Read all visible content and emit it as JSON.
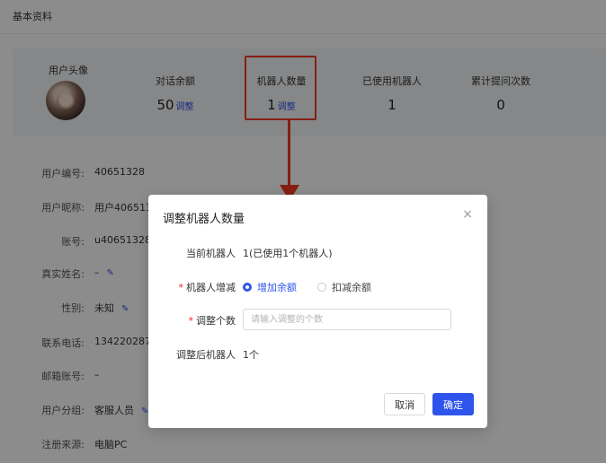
{
  "page": {
    "title": "基本资料"
  },
  "profile": {
    "avatar_label": "用户头像",
    "stats": [
      {
        "label": "对话余额",
        "value": "50",
        "adjust": "调整"
      },
      {
        "label": "机器人数量",
        "value": "1",
        "adjust": "调整"
      },
      {
        "label": "已使用机器人",
        "value": "1"
      },
      {
        "label": "累计提问次数",
        "value": "0"
      }
    ],
    "fields": [
      {
        "label": "用户编号:",
        "value": "40651328"
      },
      {
        "label": "用户昵称:",
        "value": "用户4065132"
      },
      {
        "label": "账号:",
        "value": "u40651328"
      },
      {
        "label": "真实姓名:",
        "value": "–"
      },
      {
        "label": "性别:",
        "value": "未知"
      },
      {
        "label": "联系电话:",
        "value": "1342202875"
      },
      {
        "label": "邮箱账号:",
        "value": "–"
      },
      {
        "label": "用户分组:",
        "value": "客服人员"
      },
      {
        "label": "注册来源:",
        "value": "电脑PC"
      }
    ]
  },
  "dialog": {
    "title": "调整机器人数量",
    "close_icon": "×",
    "current_label": "当前机器人",
    "current_value": "1(已使用1个机器人)",
    "change_label": "机器人增减",
    "options": [
      "增加余额",
      "扣减余额"
    ],
    "selected_option": "增加余额",
    "count_label": "调整个数",
    "count_placeholder": "请输入调整的个数",
    "after_label": "调整后机器人",
    "after_value": "1个",
    "cancel": "取消",
    "confirm": "确定"
  },
  "colors": {
    "accent": "#2f54eb",
    "annotation": "#f03b23",
    "required": "#f5222d"
  }
}
